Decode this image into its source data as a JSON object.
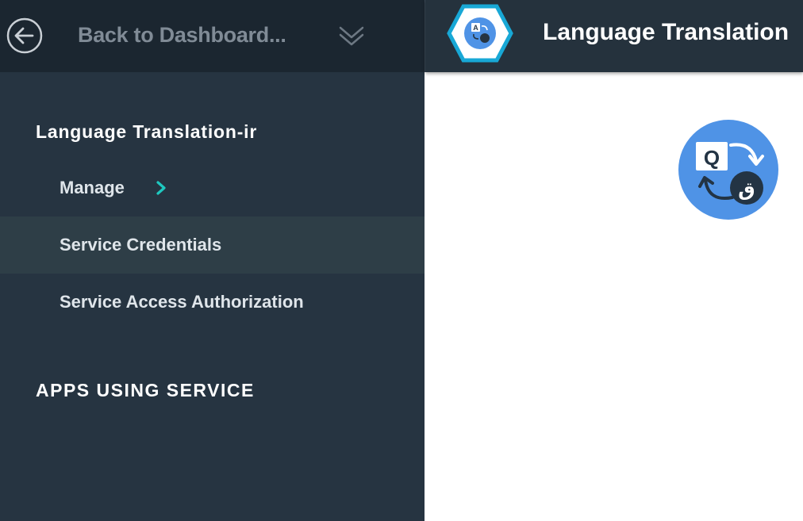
{
  "sidebar": {
    "back_label": "Back to Dashboard...",
    "service_name": "Language Translation-ir",
    "nav_items": [
      {
        "label": "Manage",
        "has_chevron": true
      },
      {
        "label": "Service Credentials",
        "selected": true
      },
      {
        "label": "Service Access Authorization"
      }
    ],
    "apps_section_title": "APPS USING SERVICE"
  },
  "header": {
    "title": "Language Translation"
  },
  "service_icon": {
    "source_glyph": "Q",
    "target_glyph": "ق"
  },
  "colors": {
    "sidebar_bg": "#263441",
    "sidebar_top_bg": "#1b2630",
    "selected_item_bg": "#2e3e47",
    "accent_teal": "#1ec8c0",
    "icon_blue": "#4f93e6",
    "hex_border": "#18a8d6"
  },
  "icons": {
    "back": "arrow-left-circle-icon",
    "dropdown": "double-chevron-down-icon",
    "nav": "chevron-right-icon",
    "service": "language-translation-icon"
  }
}
